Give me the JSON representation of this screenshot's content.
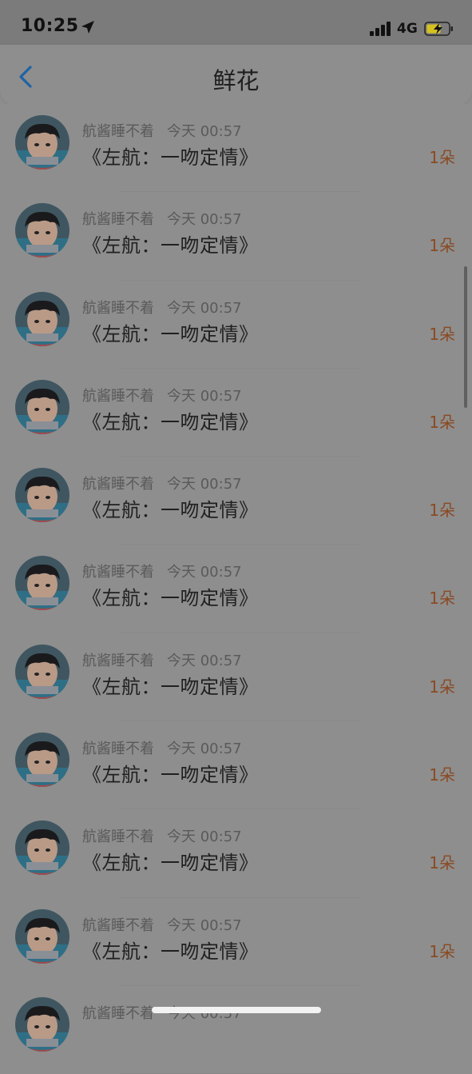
{
  "status_bar": {
    "time": "10:25",
    "network": "4G"
  },
  "nav": {
    "title": "鲜花"
  },
  "items": [
    {
      "username": "航酱睡不着",
      "time": "今天 00:57",
      "message": "《左航：一吻定情》",
      "count": "1朵"
    },
    {
      "username": "航酱睡不着",
      "time": "今天 00:57",
      "message": "《左航：一吻定情》",
      "count": "1朵"
    },
    {
      "username": "航酱睡不着",
      "time": "今天 00:57",
      "message": "《左航：一吻定情》",
      "count": "1朵"
    },
    {
      "username": "航酱睡不着",
      "time": "今天 00:57",
      "message": "《左航：一吻定情》",
      "count": "1朵"
    },
    {
      "username": "航酱睡不着",
      "time": "今天 00:57",
      "message": "《左航：一吻定情》",
      "count": "1朵"
    },
    {
      "username": "航酱睡不着",
      "time": "今天 00:57",
      "message": "《左航：一吻定情》",
      "count": "1朵"
    },
    {
      "username": "航酱睡不着",
      "time": "今天 00:57",
      "message": "《左航：一吻定情》",
      "count": "1朵"
    },
    {
      "username": "航酱睡不着",
      "time": "今天 00:57",
      "message": "《左航：一吻定情》",
      "count": "1朵"
    },
    {
      "username": "航酱睡不着",
      "time": "今天 00:57",
      "message": "《左航：一吻定情》",
      "count": "1朵"
    },
    {
      "username": "航酱睡不着",
      "time": "今天 00:57",
      "message": "《左航：一吻定情》",
      "count": "1朵"
    },
    {
      "username": "航酱睡不着",
      "time": "今天 00:57",
      "message": "",
      "count": ""
    }
  ],
  "colors": {
    "accent_back": "#1f63a6",
    "count": "#8a4a22",
    "overlay_bg": "#8e8e8e"
  }
}
